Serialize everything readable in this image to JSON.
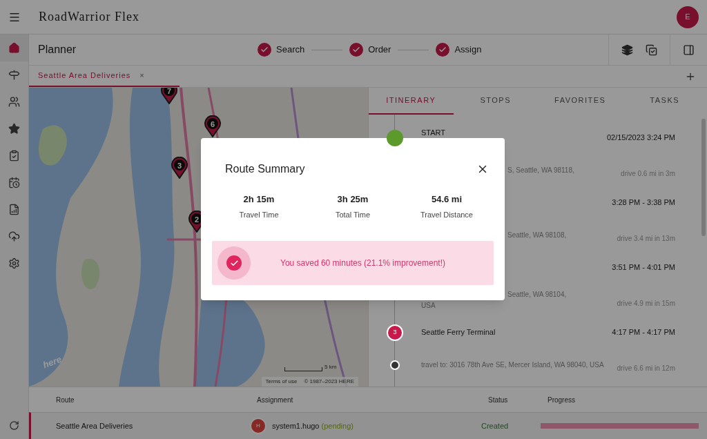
{
  "app": {
    "title": "RoadWarrior Flex",
    "avatar": "E"
  },
  "sidebar": {
    "items": [
      {
        "selected": true
      },
      {
        "selected": false
      },
      {
        "selected": false
      },
      {
        "selected": false
      },
      {
        "selected": false
      },
      {
        "selected": false
      },
      {
        "selected": false
      },
      {
        "selected": false
      },
      {
        "selected": false
      }
    ]
  },
  "header": {
    "title": "Planner",
    "steps": [
      {
        "label": "Search",
        "completed": true
      },
      {
        "label": "Order",
        "completed": true
      },
      {
        "label": "Assign",
        "completed": true
      }
    ]
  },
  "route_tabs": [
    {
      "label": "Seattle Area Deliveries",
      "close": "×",
      "selected": true
    }
  ],
  "map": {
    "pins": [
      "7",
      "6",
      "3",
      "2"
    ],
    "terms": "Terms of use",
    "copyright": "© 1987–2023 HERE",
    "scale": "5 km",
    "logo": "here"
  },
  "panel_tabs": [
    {
      "label": "ITINERARY",
      "selected": true
    },
    {
      "label": "STOPS",
      "selected": false
    },
    {
      "label": "FAVORITES",
      "selected": false
    },
    {
      "label": "TASKS",
      "selected": false
    }
  ],
  "itinerary": [
    {
      "kind": "start",
      "name": "START",
      "time": "02/15/2023 3:24 PM"
    },
    {
      "kind": "travel-covered",
      "name": "S, Seattle, WA 98118,",
      "time": "drive 0.6 mi in 3m"
    },
    {
      "kind": "stop",
      "time": "3:28 PM - 3:38 PM"
    },
    {
      "kind": "travel-covered",
      "name": "Seattle, WA 98108,",
      "time": "drive 3.4 mi in 13m"
    },
    {
      "kind": "stop",
      "time": "3:51 PM - 4:01 PM"
    },
    {
      "kind": "travel-covered",
      "name": "Seattle, WA 98104,",
      "name2": "USA",
      "time": "drive 4.9 mi in 15m"
    },
    {
      "kind": "stop",
      "number": "3",
      "name": "Seattle Ferry Terminal",
      "time": "4:17 PM - 4:17 PM"
    },
    {
      "kind": "travel",
      "name": "travel to: 3016 78th Ave SE, Mercer Island, WA 98040, USA",
      "time": "drive 6.6 mi in 12m"
    }
  ],
  "table": {
    "columns": [
      "Route",
      "Assignment",
      "Status",
      "Progress"
    ],
    "rows": [
      {
        "route": "Seattle Area Deliveries",
        "avatar": "H",
        "user": "system1.hugo",
        "note": "(pending)",
        "status": "Created",
        "level": 1
      }
    ]
  },
  "dialog": {
    "title": "Route Summary",
    "stats": [
      {
        "value": "2h 15m",
        "label": "Travel Time"
      },
      {
        "value": "3h 25m",
        "label": "Total Time"
      },
      {
        "value": "54.6 mi",
        "label": "Travel Distance"
      }
    ],
    "message": "You saved 60 minutes (21.1% improvement!)"
  }
}
